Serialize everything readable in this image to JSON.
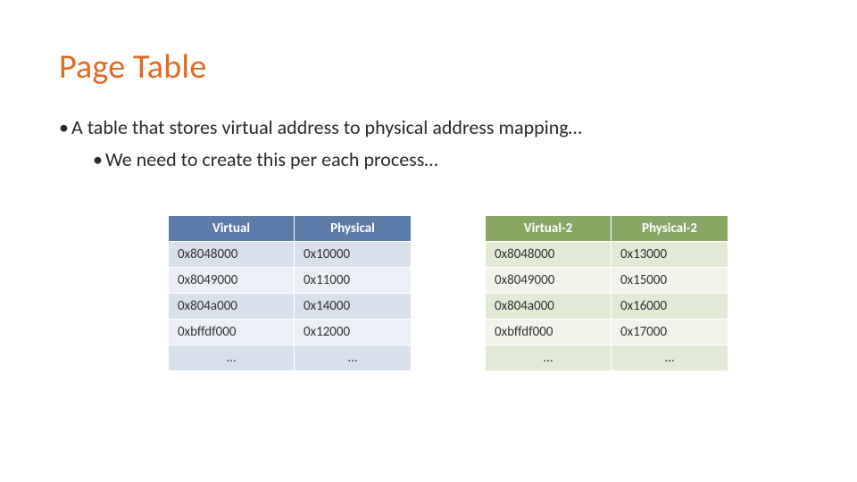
{
  "title": "Page Table",
  "bullets": {
    "level1": "A table that stores virtual address to physical address mapping…",
    "level2": "We need to create this per each process…"
  },
  "chart_data": [
    {
      "type": "table",
      "title": "Page table (process 1)",
      "headers": [
        "Virtual",
        "Physical"
      ],
      "rows": [
        [
          "0x8048000",
          "0x10000"
        ],
        [
          "0x8049000",
          "0x11000"
        ],
        [
          "0x804a000",
          "0x14000"
        ],
        [
          "0xbffdf000",
          "0x12000"
        ],
        [
          "…",
          "…"
        ]
      ]
    },
    {
      "type": "table",
      "title": "Page table (process 2)",
      "headers": [
        "Virtual-2",
        "Physical-2"
      ],
      "rows": [
        [
          "0x8048000",
          "0x13000"
        ],
        [
          "0x8049000",
          "0x15000"
        ],
        [
          "0x804a000",
          "0x16000"
        ],
        [
          "0xbffdf000",
          "0x17000"
        ],
        [
          "…",
          "…"
        ]
      ]
    }
  ]
}
